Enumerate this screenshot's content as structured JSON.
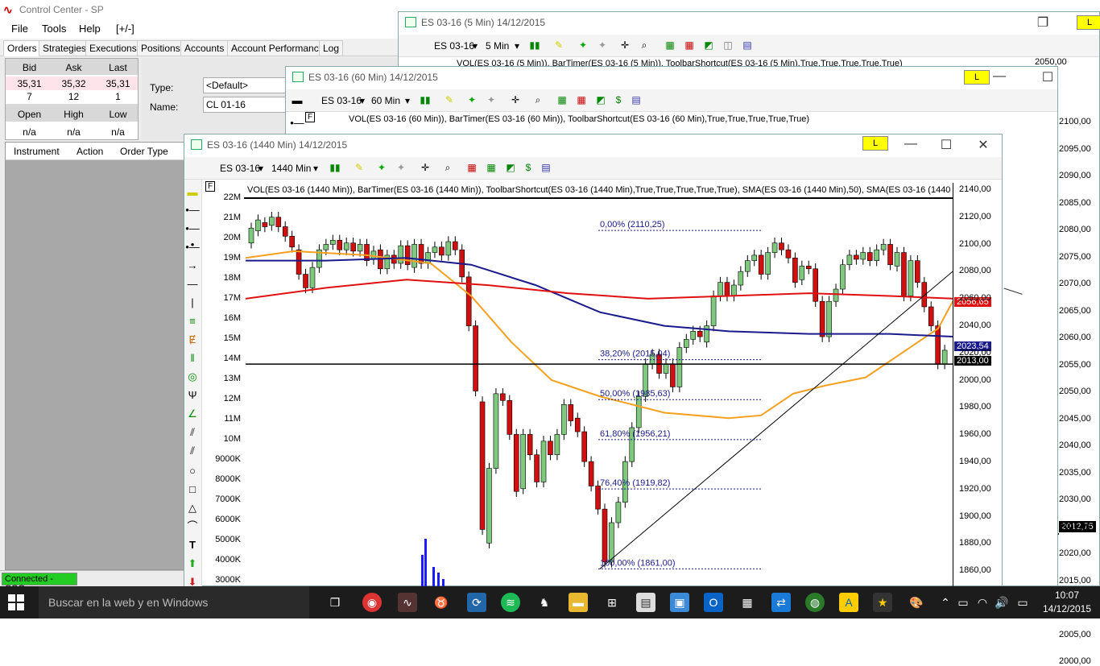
{
  "control_center": {
    "title": "Control Center - SP",
    "menu": [
      "File",
      "Tools",
      "Help",
      "[+/-]"
    ],
    "tabs": [
      "Orders",
      "Strategies",
      "Executions",
      "Positions",
      "Accounts",
      "Account Performance",
      "Log"
    ],
    "quote": {
      "headers1": [
        "Bid",
        "Ask",
        "Last"
      ],
      "row1": [
        "35,31",
        "35,32",
        "35,31"
      ],
      "row2": [
        "7",
        "12",
        "1"
      ],
      "headers2": [
        "Open",
        "High",
        "Low"
      ],
      "row3": [
        "n/a",
        "n/a",
        "n/a"
      ]
    },
    "order_form": {
      "type_label": "Type:",
      "type_value": "<Default>",
      "name_label": "Name:",
      "name_value": "CL 01-16"
    },
    "grid_headers": [
      "Instrument",
      "Action",
      "Order Type"
    ],
    "status": "Connected - CQG"
  },
  "win5": {
    "title": "ES 03-16 (5 Min)  14/12/2015",
    "instrument": "ES 03-16",
    "interval": "5 Min",
    "l_button": "L",
    "indicator": "VOL(ES 03-16 (5 Min)), BarTimer(ES 03-16 (5 Min)), ToolbarShortcut(ES 03-16 (5 Min),True,True,True,True,True)",
    "prices": [
      "2050,00",
      "2100,00",
      "2095,00",
      "2090,00",
      "2085,00",
      "2080,00",
      "2075,00",
      "2070,00",
      "2065,00",
      "2060,00",
      "2055,00",
      "2050,00",
      "2045,00",
      "2040,00",
      "2035,00",
      "2030,00",
      "2025,00",
      "2020,00",
      "2015,00",
      "2010,00",
      "2005,00",
      "2000,00"
    ],
    "last_price": "2012,75"
  },
  "win60": {
    "title": "ES 03-16 (60 Min)  14/12/2015",
    "instrument": "ES 03-16",
    "interval": "60 Min",
    "l_button": "L",
    "indicator": "VOL(ES 03-16 (60 Min)), BarTimer(ES 03-16 (60 Min)), ToolbarShortcut(ES 03-16 (60 Min),True,True,True,True,True)"
  },
  "win1440": {
    "title": "ES 03-16 (1440 Min)  14/12/2015",
    "instrument": "ES 03-16",
    "interval": "1440 Min",
    "l_button": "L",
    "indicator": "VOL(ES 03-16 (1440 Min)), BarTimer(ES 03-16 (1440 Min)), ToolbarShortcut(ES 03-16 (1440 Min),True,True,True,True,True), SMA(ES 03-16 (1440 Min),50), SMA(ES 03-16 (1440",
    "vol_axis": [
      "22M",
      "21M",
      "20M",
      "19M",
      "18M",
      "17M",
      "16M",
      "15M",
      "14M",
      "13M",
      "12M",
      "11M",
      "10M",
      "9000K",
      "8000K",
      "7000K",
      "6000K",
      "5000K",
      "4000K",
      "3000K"
    ],
    "price_axis": [
      "2140,00",
      "2120,00",
      "2100,00",
      "2080,00",
      "2060,00",
      "2040,00",
      "2020,00",
      "2000,00",
      "1980,00",
      "1960,00",
      "1940,00",
      "1920,00",
      "1900,00",
      "1880,00",
      "1860,00"
    ],
    "fib": [
      "0,00% (2110,25)",
      "38,20% (2015,04)",
      "50,00% (1985,63)",
      "61,80% (1956,21)",
      "76,40% (1919,82)",
      "100,00% (1861,00)"
    ],
    "badges": {
      "red": "2056,65",
      "blue": "2023,54",
      "black": "2013,00"
    },
    "colors": {
      "sma50": "#f5a020",
      "sma100": "#1a1a8c",
      "sma200": "#e01010",
      "up": "#7ec97e",
      "down": "#d01010"
    }
  },
  "taskbar": {
    "search": "Buscar en la web y en Windows",
    "time": "10:07",
    "date": "14/12/2015"
  }
}
